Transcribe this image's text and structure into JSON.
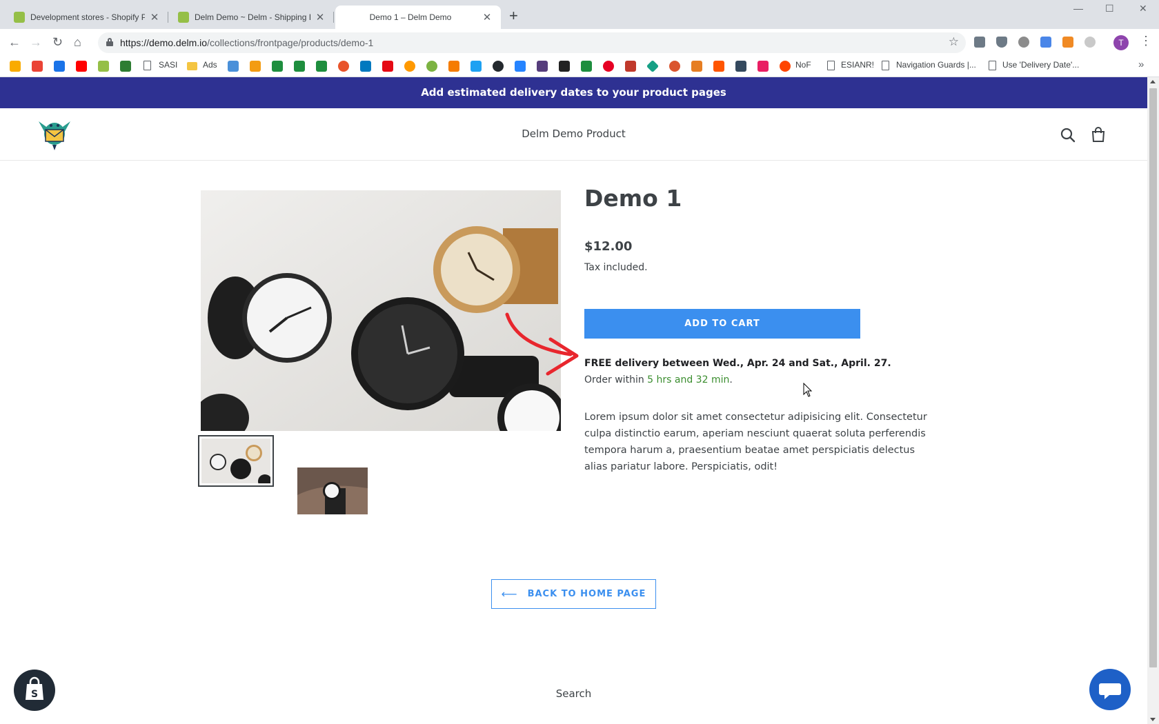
{
  "browser": {
    "tabs": [
      {
        "title": "Development stores - Shopify Pa",
        "active": false
      },
      {
        "title": "Delm Demo ~ Delm - Shipping I",
        "active": false
      },
      {
        "title": "Demo 1 – Delm Demo",
        "active": true
      }
    ],
    "address": {
      "host": "https://demo.delm.io",
      "path": "/collections/frontpage/products/demo-1"
    },
    "profile_initial": "T",
    "bookmarks": [
      "SASI",
      "Ads",
      "NoF",
      "ESIANR!",
      "Navigation Guards |...",
      "Use 'Delivery Date'..."
    ]
  },
  "page": {
    "announcement": "Add estimated delivery dates to your product pages",
    "store_name": "Delm Demo Product",
    "product": {
      "title": "Demo 1",
      "price": "$12.00",
      "tax_note": "Tax included.",
      "add_to_cart": "ADD TO CART",
      "delivery_text": "FREE delivery between Wed., Apr. 24 and Sat., April. 27.",
      "order_prefix": "Order within ",
      "order_countdown": "5 hrs and 32 min",
      "order_suffix": ".",
      "description": "Lorem ipsum dolor sit amet consectetur adipisicing elit. Consectetur culpa distinctio earum, aperiam nesciunt quaerat soluta perferendis tempora harum a, praesentium beatae amet perspiciatis delectus alias pariatur labore. Perspiciatis, odit!"
    },
    "back_button": "BACK TO HOME PAGE",
    "footer_search": "Search"
  },
  "colors": {
    "announcement_bg": "#2e3192",
    "button_blue": "#3b8fef",
    "countdown_green": "#3a8d2e",
    "annotation_arrow": "#e8262d"
  }
}
